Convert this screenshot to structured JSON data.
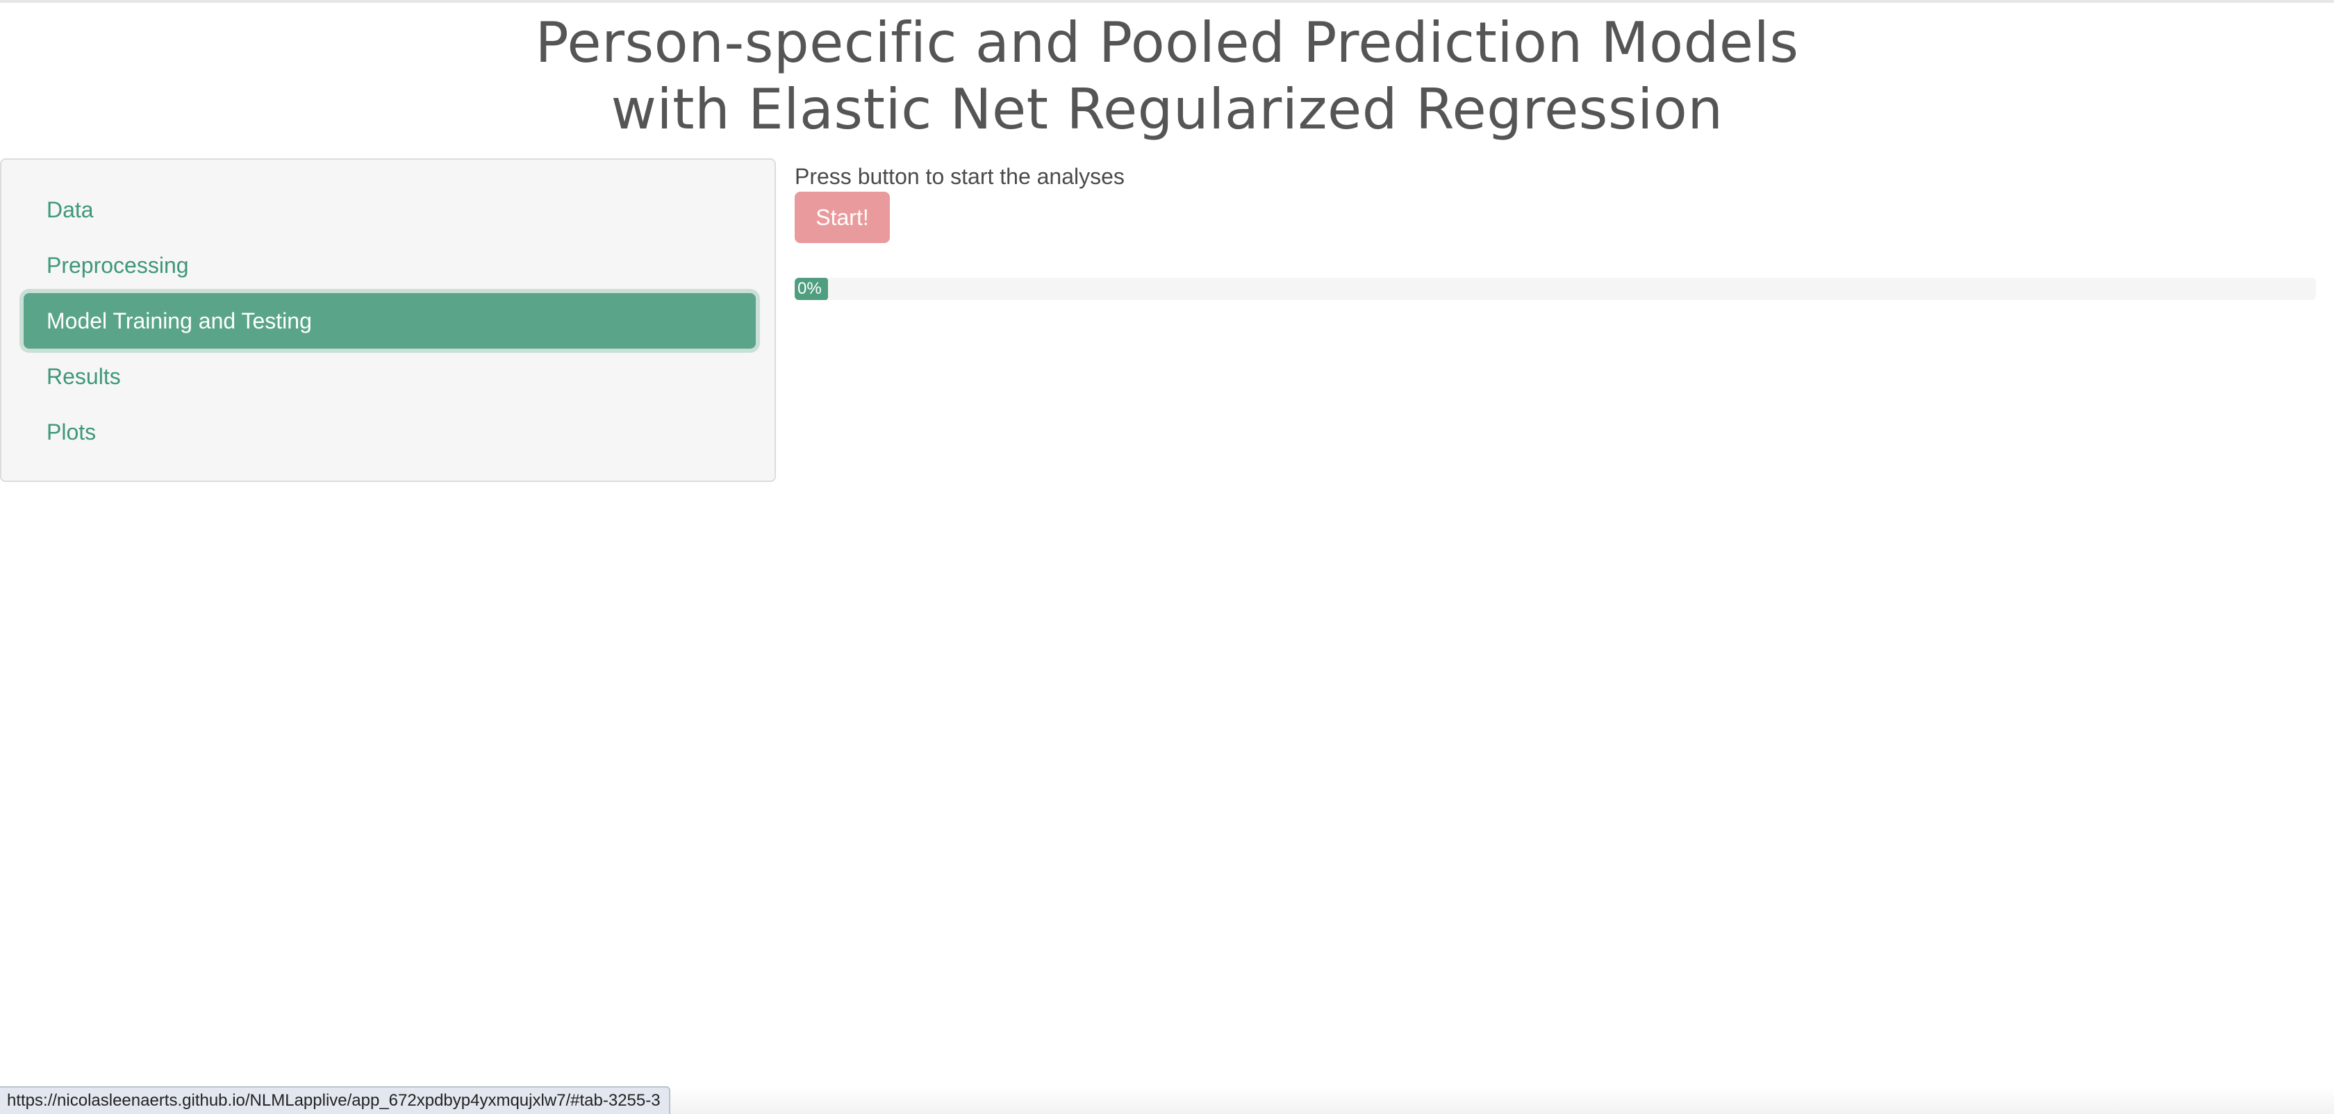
{
  "header": {
    "title_line1": "Person-specific and Pooled Prediction Models",
    "title_line2": "with Elastic Net Regularized Regression"
  },
  "sidebar": {
    "items": [
      {
        "label": "Data",
        "active": false
      },
      {
        "label": "Preprocessing",
        "active": false
      },
      {
        "label": "Model Training and Testing",
        "active": true
      },
      {
        "label": "Results",
        "active": false
      },
      {
        "label": "Plots",
        "active": false
      }
    ]
  },
  "main": {
    "prompt": "Press button to start the analyses",
    "start_label": "Start!",
    "progress": {
      "value_percent": 0,
      "label": "0%"
    }
  },
  "status_bar": {
    "url": "https://nicolasleenaerts.github.io/NLMLapplive/app_672xpdbyp4yxmqujxlw7/#tab-3255-3"
  },
  "colors": {
    "accent": "#5aa58a",
    "link": "#3e9779",
    "start_button": "#e99a9c",
    "title": "#555555"
  }
}
